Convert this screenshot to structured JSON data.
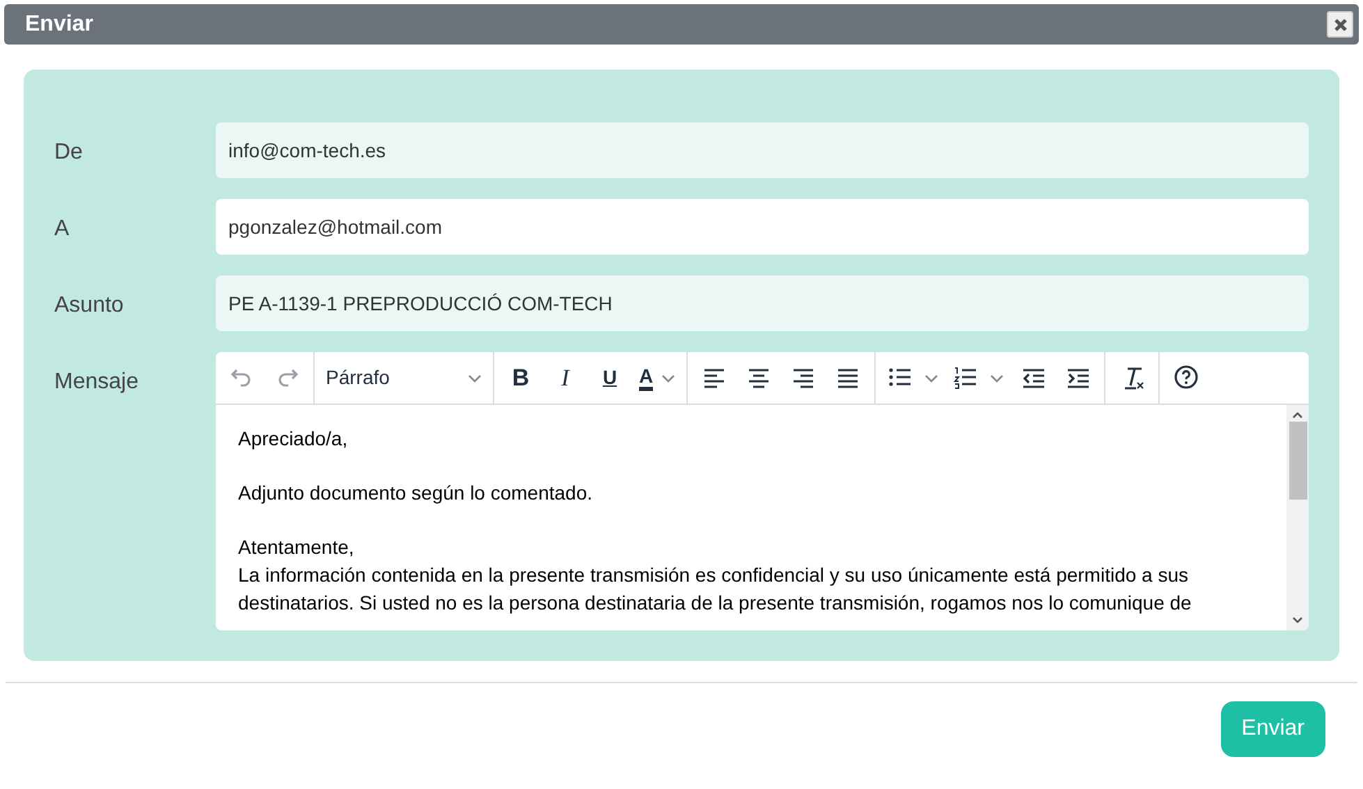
{
  "window": {
    "title": "Enviar"
  },
  "fields": [
    {
      "label": "De",
      "value": "info@com-tech.es",
      "disabled": true
    },
    {
      "label": "A",
      "value": "pgonzalez@hotmail.com",
      "disabled": false
    },
    {
      "label": "Asunto",
      "value": "PE A-1139-1 PREPRODUCCIÓ COM-TECH",
      "disabled": true
    }
  ],
  "editor": {
    "label": "Mensaje",
    "toolbar": [
      [
        {
          "kind": "undo",
          "disabled": true
        },
        {
          "kind": "redo",
          "disabled": true
        }
      ],
      [
        {
          "kind": "select",
          "label": "Párrafo"
        }
      ],
      [
        {
          "kind": "bold",
          "label": "B"
        },
        {
          "kind": "italic",
          "label": "I"
        },
        {
          "kind": "underline",
          "label": "U"
        },
        {
          "kind": "forecolor",
          "label": "A"
        }
      ],
      [
        {
          "kind": "align-left"
        },
        {
          "kind": "align-center"
        },
        {
          "kind": "align-right"
        },
        {
          "kind": "justify"
        }
      ],
      [
        {
          "kind": "bullets"
        },
        {
          "kind": "numbers"
        },
        {
          "kind": "outdent"
        },
        {
          "kind": "indent"
        }
      ],
      [
        {
          "kind": "clear-format"
        }
      ],
      [
        {
          "kind": "help"
        }
      ]
    ],
    "paragraphs": [
      [
        "Apreciado/a,"
      ],
      [
        "Adjunto documento según lo comentado."
      ],
      [
        "Atentamente,",
        "La información contenida en la presente transmisión es confidencial y su uso únicamente está permitido a sus destinatarios. Si usted no es la persona destinataria de la presente transmisión, rogamos nos lo comunique de"
      ]
    ]
  },
  "footer": {
    "button": "Enviar"
  }
}
